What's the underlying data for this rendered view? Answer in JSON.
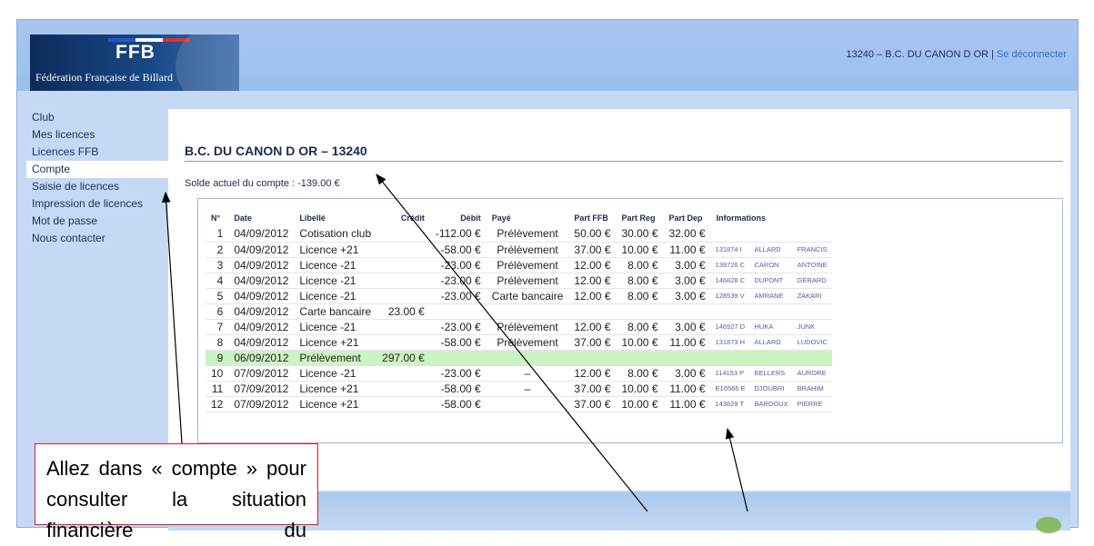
{
  "header": {
    "logo_text": "FFB",
    "logo_subtitle": "Fédération Française de Billard",
    "club_info": "13240 – B.C. DU CANON D OR",
    "separator": " | ",
    "logout_label": "Se déconnecter"
  },
  "sidebar": {
    "items": [
      {
        "label": "Club"
      },
      {
        "label": "Mes licences"
      },
      {
        "label": "Licences FFB"
      },
      {
        "label": "Compte",
        "active": true
      },
      {
        "label": "Saisie de licences"
      },
      {
        "label": "Impression de licences"
      },
      {
        "label": "Mot de passe"
      },
      {
        "label": "Nous contacter"
      }
    ]
  },
  "main": {
    "title": "B.C. DU CANON D OR – 13240",
    "balance": "Solde actuel du compte : -139.00 €"
  },
  "table": {
    "headers": [
      "N°",
      "Date",
      "Libellé",
      "Crédit",
      "Débit",
      "Payé",
      "Part FFB",
      "Part Reg",
      "Part Dep",
      "Informations"
    ],
    "rows": [
      {
        "n": "1",
        "date": "04/09/2012",
        "label": "Cotisation club",
        "credit": "",
        "debit": "-112.00 €",
        "paid": "Prélèvement",
        "ffb": "50.00 €",
        "reg": "30.00 €",
        "dep": "32.00 €",
        "lic": "",
        "last": "",
        "first": ""
      },
      {
        "n": "2",
        "date": "04/09/2012",
        "label": "Licence +21",
        "credit": "",
        "debit": "-58.00 €",
        "paid": "Prélèvement",
        "ffb": "37.00 €",
        "reg": "10.00 €",
        "dep": "11.00 €",
        "lic": "131874 I",
        "last": "ALLARD",
        "first": "FRANCIS"
      },
      {
        "n": "3",
        "date": "04/09/2012",
        "label": "Licence -21",
        "credit": "",
        "debit": "-23.00 €",
        "paid": "Prélèvement",
        "ffb": "12.00 €",
        "reg": "8.00 €",
        "dep": "3.00 €",
        "lic": "139726 C",
        "last": "CARON",
        "first": "ANTOINE"
      },
      {
        "n": "4",
        "date": "04/09/2012",
        "label": "Licence -21",
        "credit": "",
        "debit": "-23.00 €",
        "paid": "Prélèvement",
        "ffb": "12.00 €",
        "reg": "8.00 €",
        "dep": "3.00 €",
        "lic": "146828 C",
        "last": "DUPONT",
        "first": "GERARD"
      },
      {
        "n": "5",
        "date": "04/09/2012",
        "label": "Licence -21",
        "credit": "",
        "debit": "-23.00 €",
        "paid": "Carte bancaire",
        "ffb": "12.00 €",
        "reg": "8.00 €",
        "dep": "3.00 €",
        "lic": "128539 V",
        "last": "AMRANE",
        "first": "ZAKARI"
      },
      {
        "n": "6",
        "date": "04/09/2012",
        "label": "Carte bancaire",
        "credit": "23.00 €",
        "debit": "",
        "paid": "",
        "ffb": "",
        "reg": "",
        "dep": "",
        "lic": "",
        "last": "",
        "first": ""
      },
      {
        "n": "7",
        "date": "04/09/2012",
        "label": "Licence -21",
        "credit": "",
        "debit": "-23.00 €",
        "paid": "Prélèvement",
        "ffb": "12.00 €",
        "reg": "8.00 €",
        "dep": "3.00 €",
        "lic": "146927 D",
        "last": "HUKA",
        "first": "JUNK"
      },
      {
        "n": "8",
        "date": "04/09/2012",
        "label": "Licence +21",
        "credit": "",
        "debit": "-58.00 €",
        "paid": "Prélèvement",
        "ffb": "37.00 €",
        "reg": "10.00 €",
        "dep": "11.00 €",
        "lic": "131873 H",
        "last": "ALLARD",
        "first": "LUDOVIC"
      },
      {
        "n": "9",
        "date": "06/09/2012",
        "label": "Prélèvement",
        "credit": "297.00 €",
        "debit": "",
        "paid": "",
        "ffb": "",
        "reg": "",
        "dep": "",
        "lic": "",
        "last": "",
        "first": "",
        "highlight": true
      },
      {
        "n": "10",
        "date": "07/09/2012",
        "label": "Licence -21",
        "credit": "",
        "debit": "-23.00 €",
        "paid": "–",
        "ffb": "12.00 €",
        "reg": "8.00 €",
        "dep": "3.00 €",
        "lic": "114153 P",
        "last": "BELLERS",
        "first": "AURORE"
      },
      {
        "n": "11",
        "date": "07/09/2012",
        "label": "Licence +21",
        "credit": "",
        "debit": "-58.00 €",
        "paid": "–",
        "ffb": "37.00 €",
        "reg": "10.00 €",
        "dep": "11.00 €",
        "lic": "E16566 E",
        "last": "DJOUBRI",
        "first": "BRAHIM"
      },
      {
        "n": "12",
        "date": "07/09/2012",
        "label": "Licence +21",
        "credit": "",
        "debit": "-58.00 €",
        "paid": "",
        "ffb": "37.00 €",
        "reg": "10.00 €",
        "dep": "11.00 €",
        "lic": "143829 T",
        "last": "BARDOUX",
        "first": "PIERRE"
      }
    ]
  },
  "callout": {
    "text": "Allez dans « compte » pour consulter la situation financière du"
  },
  "colors": {
    "frame_bg": "#c5d9f4",
    "highlight_row": "#ccf3c2",
    "callout_border": "#d42020",
    "link": "#3c6ec8"
  }
}
